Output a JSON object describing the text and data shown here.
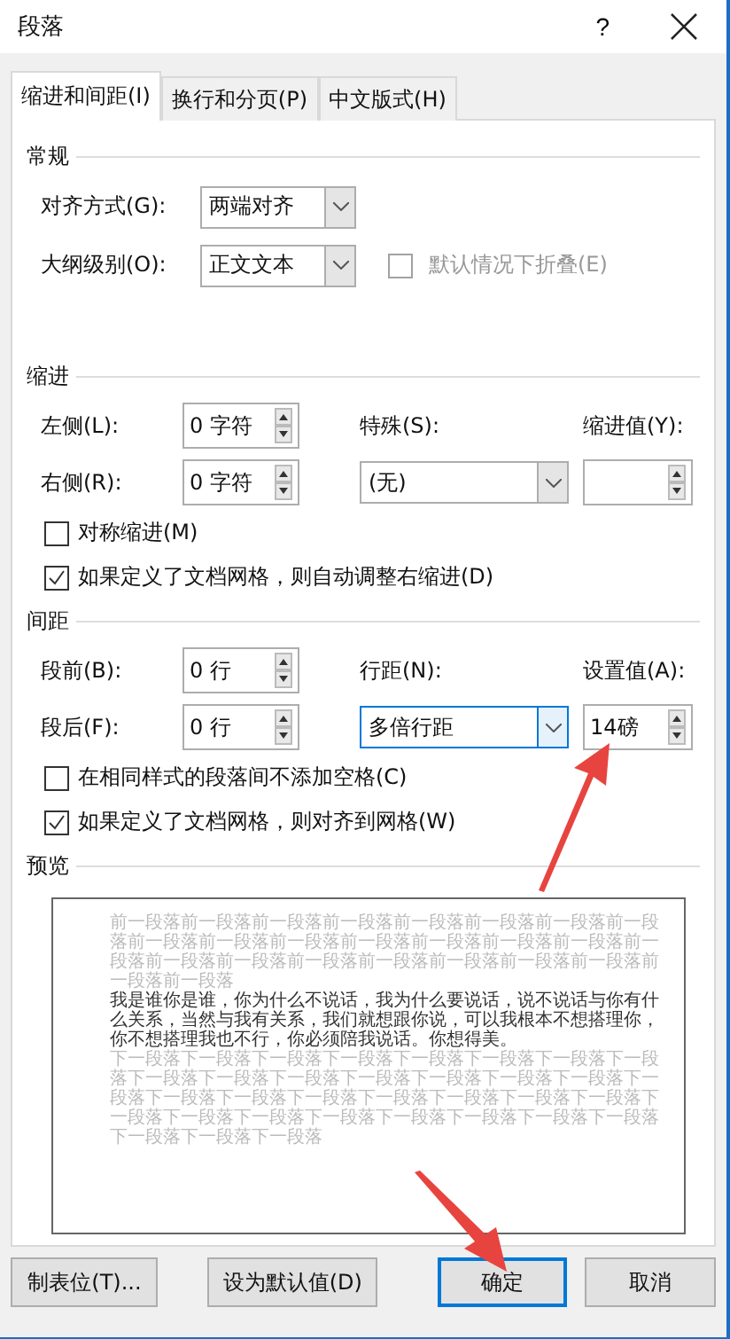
{
  "window": {
    "title": "段落",
    "help": "?"
  },
  "tabs": [
    {
      "label": "缩进和间距(I)",
      "selected": true
    },
    {
      "label": "换行和分页(P)",
      "selected": false
    },
    {
      "label": "中文版式(H)",
      "selected": false
    }
  ],
  "general": {
    "title": "常规",
    "rows": [
      {
        "label": "对齐方式(G):",
        "value": "两端对齐"
      },
      {
        "label": "大纲级别(O):",
        "value": "正文文本"
      }
    ],
    "collapse": {
      "label": "默认情况下折叠(E)",
      "checked": false,
      "disabled": true
    }
  },
  "indent": {
    "title": "缩进",
    "left": {
      "label": "左侧(L):",
      "value": "0 字符"
    },
    "right": {
      "label": "右侧(R):",
      "value": "0 字符"
    },
    "special": {
      "label": "特殊(S):",
      "value": "(无)"
    },
    "by": {
      "label": "缩进值(Y):"
    },
    "checks": [
      {
        "label": "对称缩进(M)",
        "checked": false
      },
      {
        "label": "如果定义了文档网格，则自动调整右缩进(D)",
        "checked": true
      }
    ]
  },
  "spacing": {
    "title": "间距",
    "before": {
      "label": "段前(B):",
      "value": "0 行"
    },
    "after": {
      "label": "段后(F):",
      "value": "0 行"
    },
    "line": {
      "label": "行距(N):",
      "value": "多倍行距"
    },
    "at": {
      "label": "设置值(A):",
      "value": "14磅"
    },
    "checks": [
      {
        "label": "在相同样式的段落间不添加空格(C)",
        "checked": false
      },
      {
        "label": "如果定义了文档网格，则对齐到网格(W)",
        "checked": true
      }
    ]
  },
  "preview": {
    "title": "预览",
    "before": "前一段落前一段落前一段落前一段落前一段落前一段落前一段落前一段落前一段落前一段落前一段落前一段落前一段落前一段落前一段落前一段落前一段落前一段落前一段落前一段落前一段落前一段落前一段落前一段落前一段落",
    "body": "我是谁你是谁，你为什么不说话，我为什么要说话，说不说话与你有什么关系，当然与我有关系，我们就想跟你说，可以我根本不想搭理你，你不想搭理我也不行，你必须陪我说话。你想得美。",
    "after": "下一段落下一段落下一段落下一段落下一段落下一段落下一段落下一段落下一段落下一段落下一段落下一段落下一段落下一段落下一段落下一段落下一段落下一段落下一段落下一段落下一段落下一段落下一段落下一段落下一段落下一段落下一段落下一段落下一段落下一段落下一段落下一段落下一段落下一段落"
  },
  "buttons": [
    {
      "label": "制表位(T)...",
      "focused": false
    },
    {
      "label": "设为默认值(D)",
      "focused": false
    },
    {
      "label": "确定",
      "focused": true
    },
    {
      "label": "取消",
      "focused": false
    }
  ]
}
